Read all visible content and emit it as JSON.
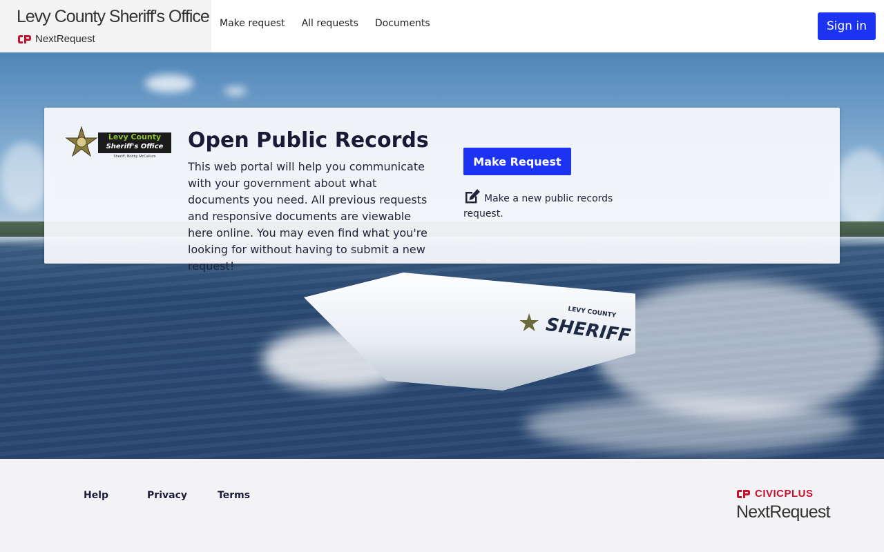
{
  "header": {
    "org_title": "Levy County Sheriff's Office",
    "product_name": "NextRequest",
    "nav": [
      {
        "label": "Make request"
      },
      {
        "label": "All requests"
      },
      {
        "label": "Documents"
      }
    ],
    "signin_label": "Sign in"
  },
  "hero": {
    "seal": {
      "line1": "Levy County",
      "line2": "Sheriff's Office",
      "line3": "Sheriff, Bobby McCallum"
    },
    "boat": {
      "county_label": "LEVY COUNTY",
      "sheriff_label": "SHERIFF"
    },
    "title": "Open Public Records",
    "description": "This web portal will help you communicate with your government about what documents you need. All previous requests and responsive documents are viewable here online. You may even find what you're looking for without having to submit a new request!",
    "make_request_label": "Make Request",
    "make_request_note": "Make a new public records request."
  },
  "footer": {
    "links": [
      {
        "label": "Help"
      },
      {
        "label": "Privacy"
      },
      {
        "label": "Terms"
      }
    ],
    "civic_brand": "CIVICPLUS",
    "civic_product": "NextRequest"
  },
  "colors": {
    "primary": "#1d33f2",
    "brand_red": "#c8102e",
    "text_dark": "#1c1c3a"
  },
  "icons": [
    "civicplus-logo-icon",
    "edit-icon",
    "sheriff-star-icon"
  ]
}
